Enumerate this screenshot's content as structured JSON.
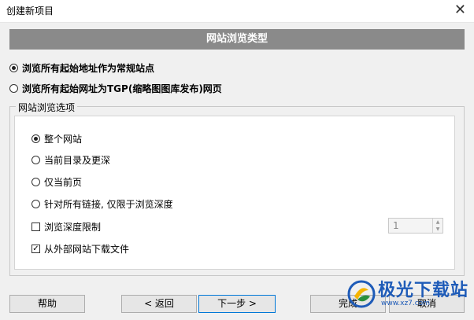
{
  "window": {
    "title": "创建新项目",
    "close_glyph": "✕"
  },
  "header": {
    "title": "网站浏览类型"
  },
  "mode_options": [
    {
      "label": "浏览所有起始地址作为常规站点",
      "selected": true
    },
    {
      "label": "浏览所有起始网址为TGP(缩略图图库发布)网页",
      "selected": false
    }
  ],
  "group": {
    "legend": "网站浏览选项",
    "scope_options": [
      {
        "label": "整个网站",
        "selected": true
      },
      {
        "label": "当前目录及更深",
        "selected": false
      },
      {
        "label": "仅当前页",
        "selected": false
      },
      {
        "label": "针对所有链接, 仅限于浏览深度",
        "selected": false
      }
    ],
    "depth_limit": {
      "label": "浏览深度限制",
      "checked": false,
      "value": "1"
    },
    "external": {
      "label": "从外部网站下载文件",
      "checked": true
    }
  },
  "buttons": {
    "help": "帮助",
    "back": "< 返回",
    "next": "下一步 >",
    "finish": "完成",
    "cancel": "取消"
  },
  "watermark": {
    "text": "极光下载站",
    "url": "www.xz7.com"
  },
  "colors": {
    "header_bg": "#8a8a8a",
    "default_border": "#0078d7",
    "watermark": "#1e5bb8"
  }
}
